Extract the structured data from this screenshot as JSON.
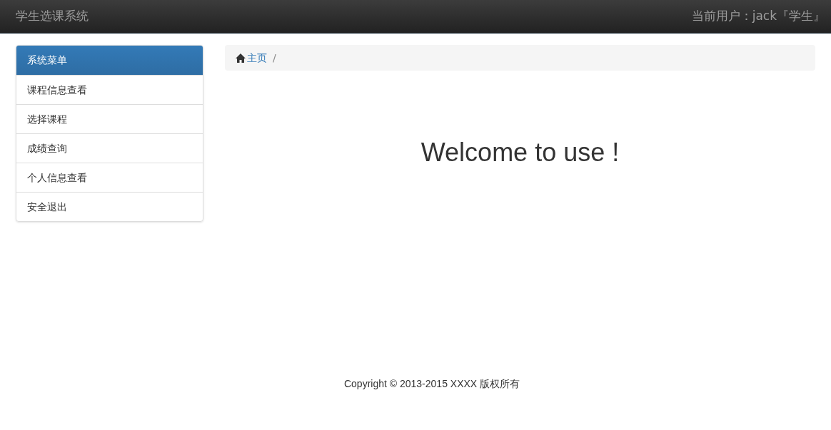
{
  "navbar": {
    "brand": "学生选课系统",
    "user": "当前用户：jack『学生』"
  },
  "sidebar": {
    "heading": "系统菜单",
    "items": [
      {
        "label": "课程信息查看"
      },
      {
        "label": "选择课程"
      },
      {
        "label": "成绩查询"
      },
      {
        "label": "个人信息查看"
      },
      {
        "label": "安全退出"
      }
    ]
  },
  "breadcrumb": {
    "items": [
      {
        "label": "主页"
      }
    ],
    "separator": "/"
  },
  "welcome": "Welcome to use !",
  "footer": "Copyright © 2013-2015 XXXX 版权所有"
}
